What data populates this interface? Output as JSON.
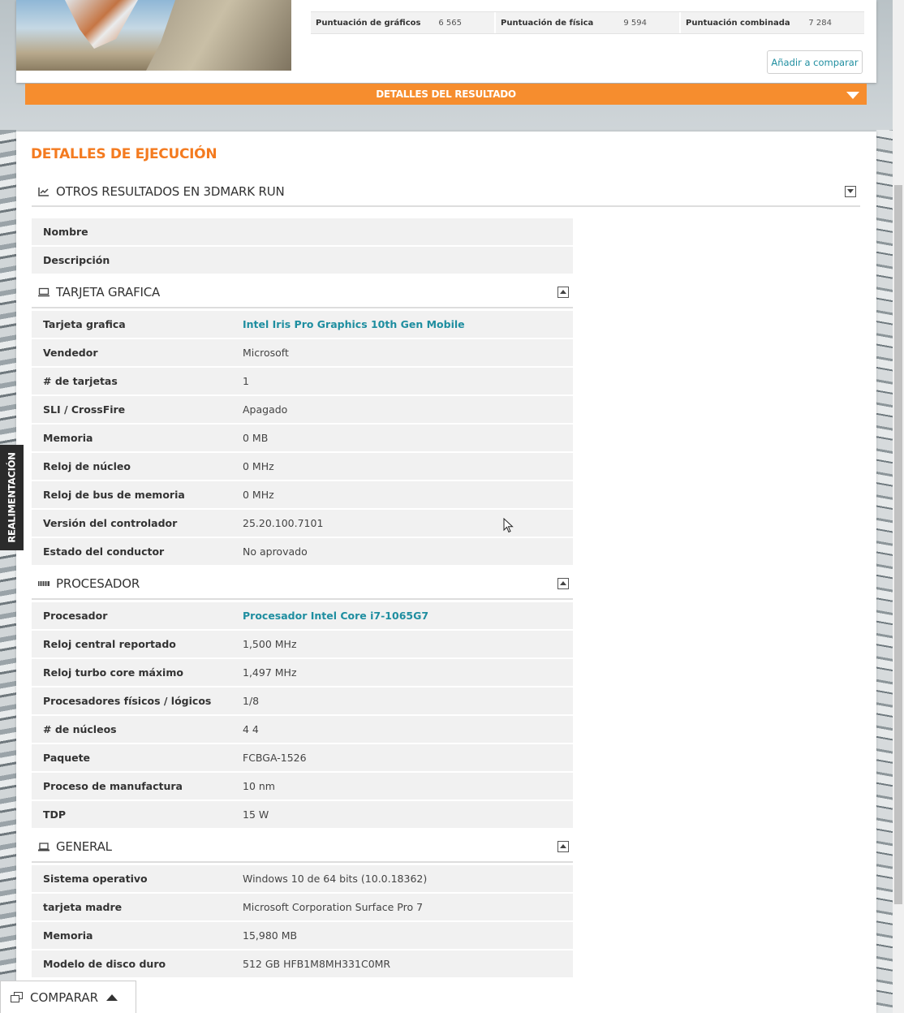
{
  "scores": [
    {
      "label": "Puntuación de gráficos",
      "value": "6 565"
    },
    {
      "label": "Puntuación de física",
      "value": "9 594"
    },
    {
      "label": "Puntuación combinada",
      "value": "7 284"
    }
  ],
  "compare_button": "Añadir a comparar",
  "result_details_bar": "DETALLES DEL RESULTADO",
  "section_title": "DETALLES DE EJECUCIÓN",
  "groups": {
    "other_results": {
      "title": "OTROS RESULTADOS EN 3DMARK RUN"
    },
    "other_results_rows": [
      {
        "key": "Nombre",
        "value": ""
      },
      {
        "key": "Descripción",
        "value": ""
      }
    ],
    "gpu": {
      "title": "TARJETA GRAFICA"
    },
    "gpu_rows": [
      {
        "key": "Tarjeta grafica",
        "value": "Intel Iris Pro Graphics 10th Gen Mobile"
      },
      {
        "key": "Vendedor",
        "value": "Microsoft"
      },
      {
        "key": "# de tarjetas",
        "value": "1"
      },
      {
        "key": "SLI / CrossFire",
        "value": "Apagado"
      },
      {
        "key": "Memoria",
        "value": "0 MB"
      },
      {
        "key": "Reloj de núcleo",
        "value": "0 MHz"
      },
      {
        "key": "Reloj de bus de memoria",
        "value": "0 MHz"
      },
      {
        "key": "Versión del controlador",
        "value": "25.20.100.7101"
      },
      {
        "key": "Estado del conductor",
        "value": "No aprovado"
      }
    ],
    "cpu": {
      "title": "PROCESADOR"
    },
    "cpu_rows": [
      {
        "key": "Procesador",
        "value": "Procesador Intel Core i7-1065G7"
      },
      {
        "key": "Reloj central reportado",
        "value": "1,500 MHz"
      },
      {
        "key": "Reloj turbo core máximo",
        "value": "1,497 MHz"
      },
      {
        "key": "Procesadores físicos / lógicos",
        "value": "1/8"
      },
      {
        "key": "# de núcleos",
        "value": "4 4"
      },
      {
        "key": "Paquete",
        "value": "FCBGA-1526"
      },
      {
        "key": "Proceso de manufactura",
        "value": "10 nm"
      },
      {
        "key": "TDP",
        "value": "15 W"
      }
    ],
    "general": {
      "title": "GENERAL"
    },
    "general_rows": [
      {
        "key": "Sistema operativo",
        "value": "Windows 10 de 64 bits (10.0.18362)"
      },
      {
        "key": "tarjeta madre",
        "value": "Microsoft Corporation Surface Pro 7"
      },
      {
        "key": "Memoria",
        "value": "15,980 MB"
      },
      {
        "key": "Modelo de disco duro",
        "value": "512 GB HFB1M8MH331C0MR"
      }
    ]
  },
  "feedback_tab": "REALIMENTACIÓN",
  "compare_bar": "COMPARAR",
  "colors": {
    "accent_orange": "#f68d2e",
    "title_orange": "#f47b20",
    "link_teal": "#1f8ea0"
  },
  "icons": [
    "chart-icon",
    "monitor-icon",
    "cpu-icon",
    "laptop-icon",
    "collapse-icon",
    "expand-icon",
    "compare-icon"
  ]
}
